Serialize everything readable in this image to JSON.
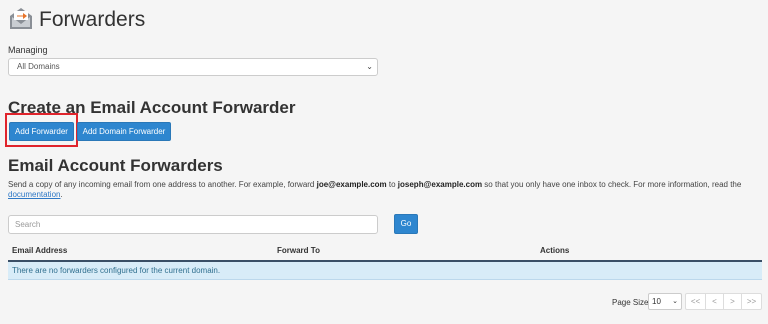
{
  "header": {
    "title": "Forwarders",
    "icon": "envelope-forward-icon"
  },
  "managing": {
    "label": "Managing",
    "selected": "All Domains",
    "chevron": "⌄"
  },
  "create_section": {
    "title": "Create an Email Account Forwarder",
    "add_forwarder_label": "Add Forwarder",
    "add_domain_forwarder_label": "Add Domain Forwarder"
  },
  "forwarders_section": {
    "title": "Email Account Forwarders",
    "desc_part1": "Send a copy of any incoming email from one address to another. For example, forward ",
    "desc_email1": "joe@example.com",
    "desc_part2": " to ",
    "desc_email2": "joseph@example.com",
    "desc_part3": " so that you only have one inbox to check. For more information, read the ",
    "desc_link": "documentation",
    "desc_part4": "."
  },
  "search": {
    "placeholder": "Search",
    "go_label": "Go"
  },
  "table": {
    "columns": [
      "Email Address",
      "Forward To",
      "Actions"
    ],
    "empty_message": "There are no forwarders configured for the current domain."
  },
  "pagination": {
    "page_size_label": "Page Size",
    "page_size_value": "10",
    "first": "<<",
    "prev": "<",
    "next": ">",
    "last": ">>"
  },
  "colors": {
    "primary_button": "#2e86cf",
    "highlight": "#e0242c",
    "empty_row_bg": "#d8ecf8",
    "link": "#2e78c6"
  }
}
